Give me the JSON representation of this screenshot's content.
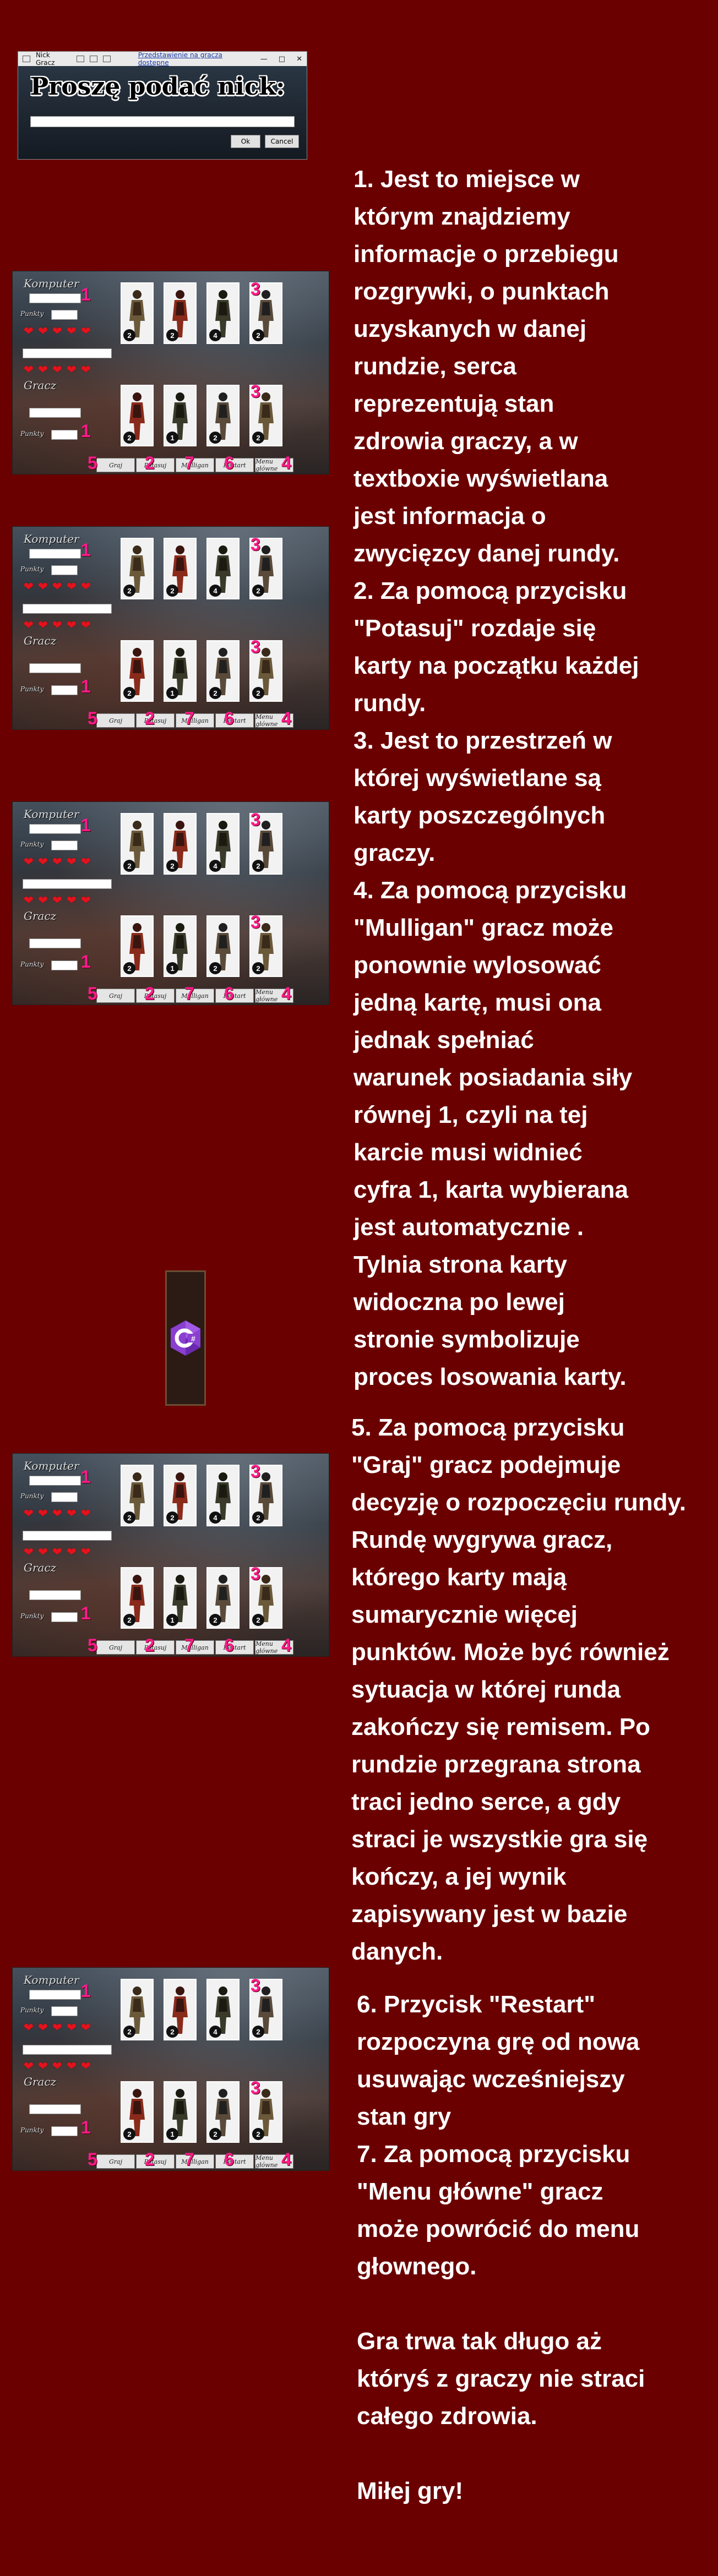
{
  "nick_dialog": {
    "title": "Nick Gracz",
    "link_text": "Przedstawienie na gracza dostępne",
    "prompt": "Proszę podać nick:",
    "input_value": "",
    "ok_label": "Ok",
    "cancel_label": "Cancel"
  },
  "game": {
    "computer_label": "Komputer",
    "player_label": "Gracz",
    "points_label": "Punkty",
    "hearts": 5,
    "buttons": [
      "Graj",
      "Potasuj",
      "Mulligan",
      "Restart",
      "Menu główne"
    ],
    "computer_card_values": [
      "2",
      "2",
      "4",
      "2"
    ],
    "player_card_values": [
      "2",
      "1",
      "2",
      "2"
    ],
    "marker_numbers": {
      "n1": "1",
      "n2": "2",
      "n3": "3",
      "n4": "4",
      "n5": "5",
      "n6": "6",
      "n7": "7"
    }
  },
  "texts": {
    "block1": [
      "1. Jest to miejsce w",
      "którym znajdziemy",
      "informacje o przebiegu",
      "rozgrywki, o punktach",
      "uzyskanych w danej",
      "rundzie, serca",
      "reprezentują stan",
      "zdrowia graczy, a w",
      "textboxie wyświetlana",
      "jest informacja o",
      "zwycięzcy danej rundy.",
      "2. Za pomocą przycisku",
      "\"Potasuj\" rozdaje się",
      "karty na początku każdej",
      "rundy.",
      "3. Jest to przestrzeń w",
      "której wyświetlane są",
      "karty poszczególnych",
      "graczy.",
      "4. Za pomocą przycisku",
      "\"Mulligan\" gracz może",
      "ponownie wylosować",
      "jedną kartę, musi ona",
      "jednak spełniać",
      "warunek posiadania siły",
      "równej 1, czyli na tej",
      "karcie musi widnieć",
      "cyfra 1, karta wybierana",
      "jest automatycznie .",
      "Tylnia strona karty",
      "widoczna po lewej",
      "stronie symbolizuje",
      "proces losowania karty."
    ],
    "block2": [
      "5. Za pomocą przycisku",
      "\"Graj\" gracz podejmuje",
      "decyzję o rozpoczęciu rundy.",
      "Rundę wygrywa gracz,",
      "którego karty mają",
      "sumarycznie więcej",
      "punktów. Może być również",
      "sytuacja w której runda",
      "zakończy się remisem. Po",
      "rundzie przegrana strona",
      "traci jedno serce, a gdy",
      "straci je wszystkie gra się",
      "kończy, a jej wynik",
      "zapisywany jest w bazie",
      "danych."
    ],
    "block3": [
      "6. Przycisk \"Restart\"",
      "rozpoczyna grę od nowa",
      "usuwając wcześniejszy",
      "stan gry",
      "7. Za pomocą przycisku",
      "\"Menu główne\" gracz",
      "może powrócić do menu",
      "głownego.",
      "",
      "Gra trwa tak długo aż",
      "któryś z graczy nie straci",
      "całego zdrowia.",
      "",
      "Miłej gry!"
    ]
  },
  "colors": {
    "background": "#6b0000",
    "marker": "#ff1a8c",
    "heart": "#e3121c"
  }
}
